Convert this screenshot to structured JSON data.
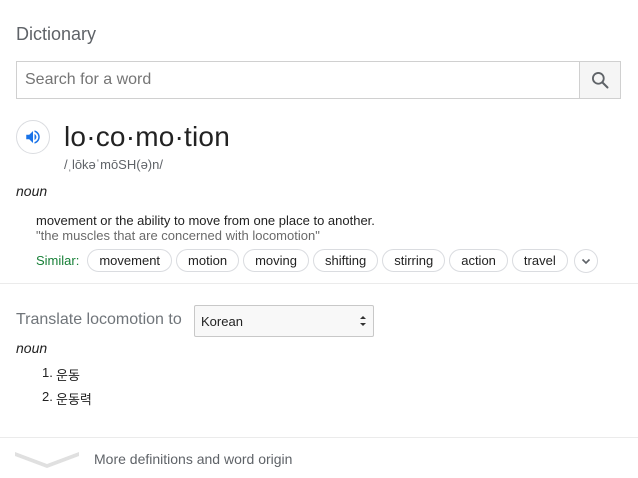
{
  "header": {
    "title": "Dictionary"
  },
  "search": {
    "placeholder": "Search for a word",
    "value": "",
    "icon": "search-icon"
  },
  "entry": {
    "word": "lo·co·mo·tion",
    "phonetic": "/ˌlōkəˈmōSH(ə)n/",
    "part_of_speech": "noun",
    "definition": "movement or the ability to move from one place to another.",
    "example": "\"the muscles that are concerned with locomotion\"",
    "similar_label": "Similar:",
    "similar": [
      "movement",
      "motion",
      "moving",
      "shifting",
      "stirring",
      "action",
      "travel"
    ]
  },
  "translate": {
    "label": "Translate locomotion to",
    "language": "Korean",
    "part_of_speech": "noun",
    "items": [
      {
        "num": "1.",
        "text": "운동"
      },
      {
        "num": "2.",
        "text": "운동력"
      }
    ]
  },
  "footer": {
    "more_label": "More definitions and word origin"
  },
  "colors": {
    "similar_label": "#188038",
    "speaker": "#1a73e8"
  }
}
